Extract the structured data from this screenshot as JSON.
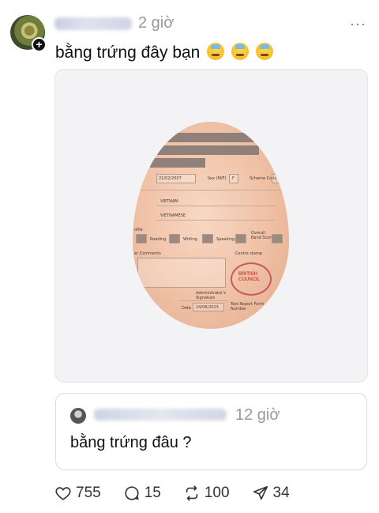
{
  "post": {
    "time": "2 giờ",
    "more": "···",
    "text": "bằng trứng đây bạn"
  },
  "image": {
    "cert": {
      "date": "21/02/2007",
      "sex_label": "Sex (M/F)",
      "sex": "F",
      "scheme": "Scheme Code",
      "country": "VIETNAM",
      "language": "VIETNAMESE",
      "profile": "ofile",
      "reading": "Reading",
      "writing": "Writing",
      "speaking": "Speaking",
      "overall": "Overall Band Score",
      "comments": "er Comments",
      "centre_stamp": "Centre stamp",
      "admin_sig": "Administrator's Signature",
      "date_label": "Date",
      "date_value": "24/06/2023",
      "trf": "Test Report Form Number",
      "stamp_text": "BRITISH COUNCIL"
    }
  },
  "quote": {
    "time": "12 giờ",
    "text": "bằng trứng đâu ?"
  },
  "actions": {
    "likes": "755",
    "replies": "15",
    "reposts": "100",
    "shares": "34"
  }
}
